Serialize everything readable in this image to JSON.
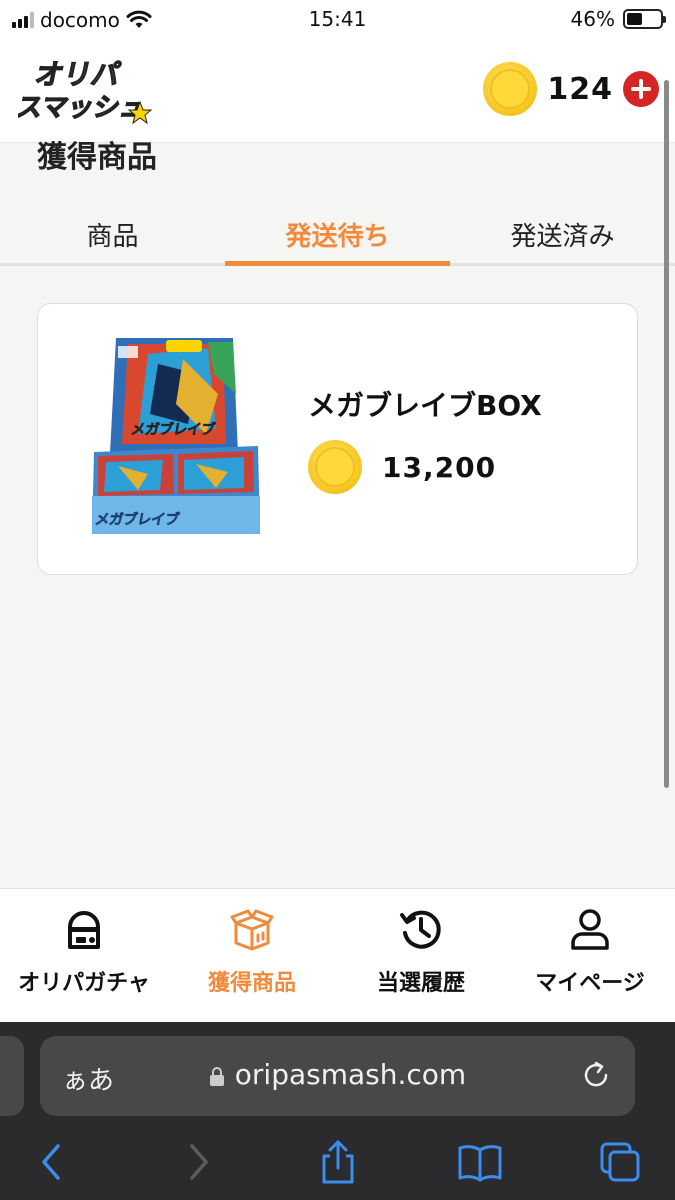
{
  "status_bar": {
    "carrier": "docomo",
    "time": "15:41",
    "battery": "46%",
    "battery_level": 0.46
  },
  "header": {
    "logo_text_line1": "オリパ",
    "logo_text_line2": "スマッシュ",
    "coin_balance": "124"
  },
  "page": {
    "title": "獲得商品"
  },
  "tabs": [
    {
      "label": "商品",
      "active": false
    },
    {
      "label": "発送待ち",
      "active": true
    },
    {
      "label": "発送済み",
      "active": false
    }
  ],
  "product": {
    "name": "メガブレイブBOX",
    "price": "13,200"
  },
  "bottom_nav": [
    {
      "label": "オリパガチャ",
      "icon": "gacha-machine-icon",
      "active": false
    },
    {
      "label": "獲得商品",
      "icon": "box-icon",
      "active": true
    },
    {
      "label": "当選履歴",
      "icon": "history-icon",
      "active": false
    },
    {
      "label": "マイページ",
      "icon": "user-icon",
      "active": false
    }
  ],
  "browser": {
    "text_size_label": "ぁあ",
    "url": "oripasmash.com"
  },
  "colors": {
    "accent": "#f08a3c",
    "add_button": "#d62525",
    "coin": "#f6c623"
  }
}
